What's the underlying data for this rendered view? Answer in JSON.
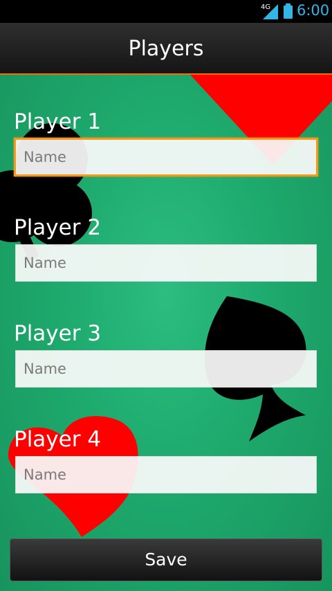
{
  "status_bar": {
    "network": "4G",
    "time": "6:00",
    "accent_color": "#33b5e5"
  },
  "action_bar": {
    "title": "Players",
    "accent_color": "#ff6a00"
  },
  "background": {
    "felt_color": "#1ea96d",
    "suits": [
      "diamond",
      "club",
      "spade",
      "heart"
    ]
  },
  "players": [
    {
      "label": "Player 1",
      "placeholder": "Name",
      "value": "",
      "focused": true
    },
    {
      "label": "Player 2",
      "placeholder": "Name",
      "value": "",
      "focused": false
    },
    {
      "label": "Player 3",
      "placeholder": "Name",
      "value": "",
      "focused": false
    },
    {
      "label": "Player 4",
      "placeholder": "Name",
      "value": "",
      "focused": false
    }
  ],
  "save_button": {
    "label": "Save"
  }
}
